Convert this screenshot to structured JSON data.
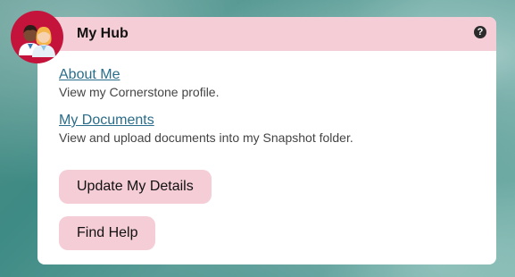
{
  "hub": {
    "title": "My Hub",
    "help_icon": "question-circle-icon",
    "help_glyph": "?",
    "avatar_icon": "people-icon"
  },
  "links": [
    {
      "label": "About Me",
      "description": "View my Cornerstone profile."
    },
    {
      "label": "My Documents",
      "description": "View and upload documents into my Snapshot folder."
    }
  ],
  "buttons": {
    "update_details": "Update My Details",
    "find_help": "Find Help"
  },
  "colors": {
    "header_bg": "#f5cdd6",
    "avatar_bg": "#c4143c",
    "link": "#2a6d8a",
    "button_bg": "#f5cdd6"
  }
}
